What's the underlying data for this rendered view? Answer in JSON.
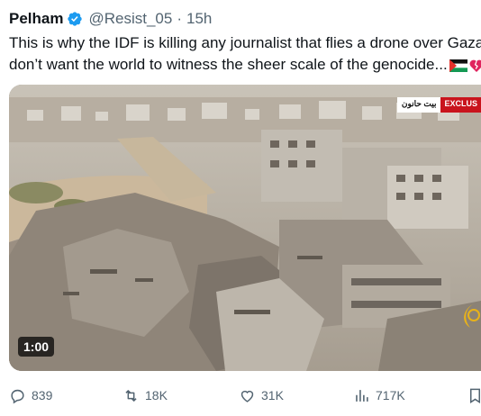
{
  "tweet": {
    "author_name": "Pelham",
    "handle": "@Resist_05",
    "separator": "·",
    "time": "15h",
    "text_line1": "This is why the IDF is killing any journalist that flies a drone over Gaza,",
    "text_line2": "don’t want the world to witness the sheer scale of the genocide...",
    "emojis": [
      "palestine-flag-icon",
      "broken-heart-icon"
    ]
  },
  "media": {
    "duration": "1:00",
    "channel_badge_arabic": "بيت حانون",
    "channel_badge": "EXCLUS"
  },
  "actions": {
    "replies": "839",
    "reposts": "18K",
    "likes": "31K",
    "views": "717K"
  },
  "colors": {
    "verified": "#1d9bf0",
    "secondary_text": "#536471",
    "badge_red": "#c9141d"
  }
}
